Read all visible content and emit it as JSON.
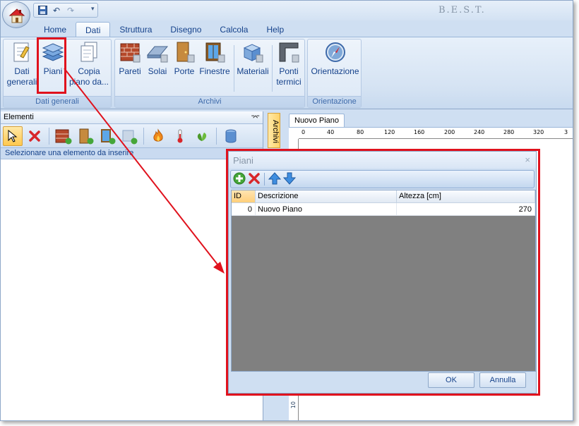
{
  "app": {
    "title": "B.E.S.T."
  },
  "ribbon_tabs": [
    {
      "label": "Home"
    },
    {
      "label": "Dati"
    },
    {
      "label": "Struttura"
    },
    {
      "label": "Disegno"
    },
    {
      "label": "Calcola"
    },
    {
      "label": "Help"
    }
  ],
  "ribbon": {
    "dati_generali": {
      "label": "Dati generali",
      "buttons": {
        "dati_generali_line1": "Dati",
        "dati_generali_line2": "generali",
        "piani": "Piani",
        "copia_line1": "Copia",
        "copia_line2": "piano da..."
      }
    },
    "archivi": {
      "label": "Archivi",
      "buttons": {
        "pareti": "Pareti",
        "solai": "Solai",
        "porte": "Porte",
        "finestre": "Finestre",
        "materiali": "Materiali",
        "ponti_line1": "Ponti",
        "ponti_line2": "termici"
      }
    },
    "orientazione": {
      "label": "Orientazione",
      "buttons": {
        "orientazione": "Orientazione"
      }
    }
  },
  "elements_panel": {
    "title": "Elementi",
    "pin": "⌤",
    "hint": "Selezionare una elemento da inserire"
  },
  "archivi_strip": {
    "label": "Archivi"
  },
  "document": {
    "tab": "Nuovo Piano",
    "ruler_ticks": [
      "0",
      "40",
      "80",
      "120",
      "160",
      "200",
      "240",
      "280",
      "320",
      "3"
    ],
    "vertical_ticks": [
      "10"
    ]
  },
  "dialog": {
    "title": "Piani",
    "close": "×",
    "columns": {
      "id": "ID",
      "descrizione": "Descrizione",
      "altezza": "Altezza [cm]"
    },
    "rows": [
      {
        "id": "0",
        "descrizione": "Nuovo Piano",
        "altezza": "270"
      }
    ],
    "ok": "OK",
    "annulla": "Annulla"
  },
  "colors": {
    "highlight": "#e0121d",
    "ribbon_text": "#15428b",
    "grid_empty": "#808080"
  }
}
